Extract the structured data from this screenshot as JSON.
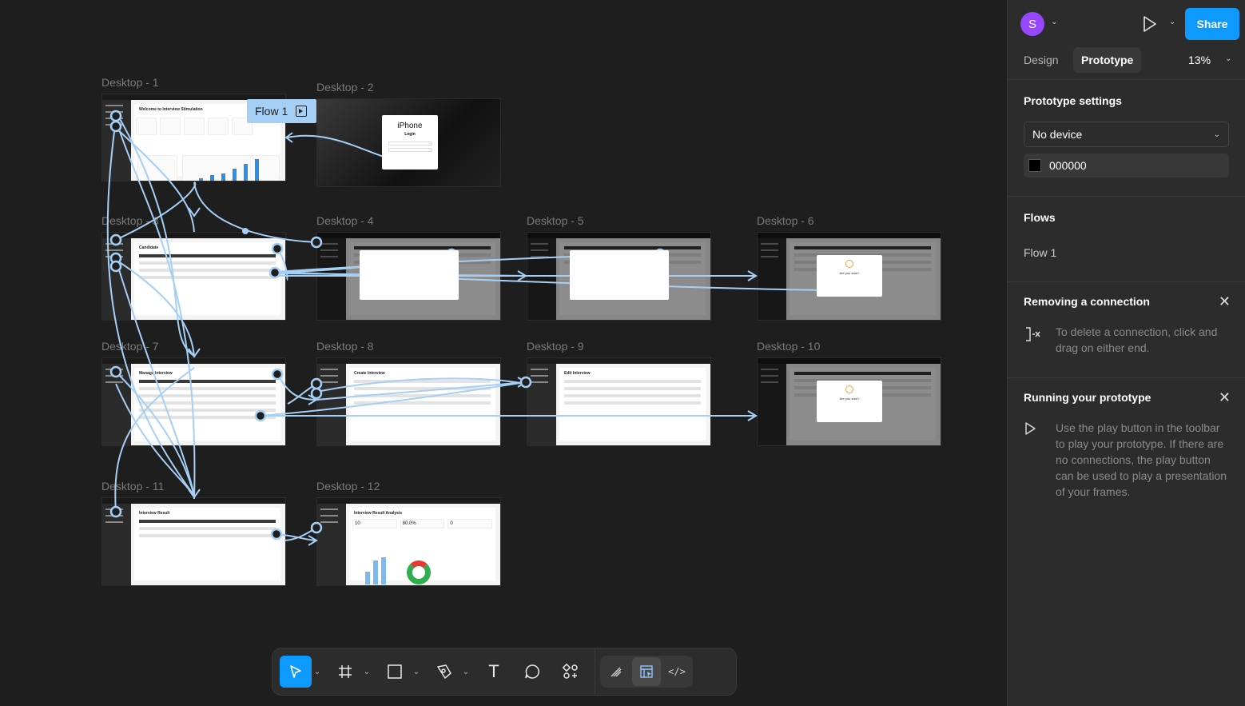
{
  "canvas": {
    "frames": [
      {
        "id": "d1",
        "label": "Desktop - 1"
      },
      {
        "id": "d2",
        "label": "Desktop - 2"
      },
      {
        "id": "d3",
        "label": "Desktop - 3"
      },
      {
        "id": "d4",
        "label": "Desktop - 4"
      },
      {
        "id": "d5",
        "label": "Desktop - 5"
      },
      {
        "id": "d6",
        "label": "Desktop - 6"
      },
      {
        "id": "d7",
        "label": "Desktop - 7"
      },
      {
        "id": "d8",
        "label": "Desktop - 8"
      },
      {
        "id": "d9",
        "label": "Desktop - 9"
      },
      {
        "id": "d10",
        "label": "Desktop - 10"
      },
      {
        "id": "d11",
        "label": "Desktop - 11"
      },
      {
        "id": "d12",
        "label": "Desktop - 12"
      }
    ],
    "flow_badge": "Flow 1",
    "frame_texts": {
      "d1_title": "Welcome to Interview Stimulation",
      "d2_brand": "iPhone",
      "d2_login": "Login",
      "d3_title": "Candidate",
      "d7_title": "Manage Interview",
      "d8_title": "Create Interview",
      "d9_title": "Edit Interview",
      "d11_title": "Interview Result",
      "d12_title": "Interview Result Analysis",
      "d12_total": "10",
      "d12_pass": "80.0%",
      "d12_selected": "0",
      "confirm": "Are you sure?"
    },
    "connection_color": "#a6cff5"
  },
  "toolbar": {
    "tools": [
      {
        "name": "move",
        "icon": "cursor-arrow-icon",
        "active": true
      },
      {
        "name": "frame",
        "icon": "frame-hash-icon"
      },
      {
        "name": "shape",
        "icon": "rectangle-icon"
      },
      {
        "name": "pen",
        "icon": "pen-icon"
      },
      {
        "name": "text",
        "icon": "text-icon",
        "glyph": "T"
      },
      {
        "name": "comment",
        "icon": "comment-bubble-icon"
      },
      {
        "name": "actions",
        "icon": "actions-icon"
      }
    ],
    "modes": [
      {
        "name": "draw",
        "icon": "draw-mode-icon"
      },
      {
        "name": "design",
        "icon": "design-mode-icon",
        "active": true
      },
      {
        "name": "dev",
        "icon": "dev-mode-icon",
        "glyph": "</>"
      }
    ],
    "accent": "#0d99ff"
  },
  "help": "?",
  "panel": {
    "avatar_initial": "S",
    "avatar_color": "#9747ff",
    "share_label": "Share",
    "tabs": [
      "Design",
      "Prototype"
    ],
    "active_tab": "Prototype",
    "zoom": "13%",
    "prototype_settings": {
      "heading": "Prototype settings",
      "device": "No device",
      "background": "000000"
    },
    "flows": {
      "heading": "Flows",
      "items": [
        "Flow 1"
      ]
    },
    "removing": {
      "heading": "Removing a connection",
      "text": "To delete a connection, click and drag on either end."
    },
    "running": {
      "heading": "Running your prototype",
      "text": "Use the play button in the toolbar to play your prototype. If there are no connections, the play button can be used to play a presentation of your frames."
    }
  }
}
